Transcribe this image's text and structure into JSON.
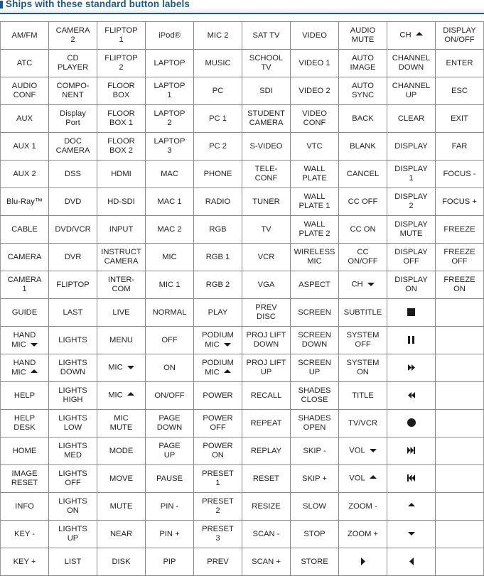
{
  "header": {
    "title": "Ships with these standard button labels",
    "accent_color": "#1a5a8a"
  },
  "table": {
    "columns": 10,
    "rows": [
      [
        {
          "text": "AM/FM"
        },
        {
          "text": "CAMERA\n2"
        },
        {
          "text": "FLIPTOP\n1"
        },
        {
          "text": "iPod®"
        },
        {
          "text": "MIC 2"
        },
        {
          "text": "SAT TV"
        },
        {
          "text": "VIDEO"
        },
        {
          "text": "AUDIO\nMUTE"
        },
        {
          "text": "CH",
          "icon": "triangle-up"
        },
        {
          "text": "DISPLAY\nON/OFF"
        }
      ],
      [
        {
          "text": "ATC"
        },
        {
          "text": "CD\nPLAYER"
        },
        {
          "text": "FLIPTOP\n2"
        },
        {
          "text": "LAPTOP"
        },
        {
          "text": "MUSIC"
        },
        {
          "text": "SCHOOL\nTV"
        },
        {
          "text": "VIDEO 1"
        },
        {
          "text": "AUTO\nIMAGE"
        },
        {
          "text": "CHANNEL\nDOWN"
        },
        {
          "text": "ENTER"
        }
      ],
      [
        {
          "text": "AUDIO\nCONF"
        },
        {
          "text": "COMPO-\nNENT"
        },
        {
          "text": "FLOOR\nBOX"
        },
        {
          "text": "LAPTOP\n1"
        },
        {
          "text": "PC"
        },
        {
          "text": "SDI"
        },
        {
          "text": "VIDEO 2"
        },
        {
          "text": "AUTO\nSYNC"
        },
        {
          "text": "CHANNEL\nUP"
        },
        {
          "text": "ESC"
        }
      ],
      [
        {
          "text": "AUX"
        },
        {
          "text": "Display\nPort"
        },
        {
          "text": "FLOOR\nBOX 1"
        },
        {
          "text": "LAPTOP\n2"
        },
        {
          "text": "PC 1"
        },
        {
          "text": "STUDENT\nCAMERA"
        },
        {
          "text": "VIDEO\nCONF"
        },
        {
          "text": "BACK"
        },
        {
          "text": "CLEAR"
        },
        {
          "text": "EXIT"
        }
      ],
      [
        {
          "text": "AUX 1"
        },
        {
          "text": "DOC\nCAMERA"
        },
        {
          "text": "FLOOR\nBOX 2"
        },
        {
          "text": "LAPTOP\n3"
        },
        {
          "text": "PC 2"
        },
        {
          "text": "S-VIDEO"
        },
        {
          "text": "VTC"
        },
        {
          "text": "BLANK"
        },
        {
          "text": "DISPLAY"
        },
        {
          "text": "FAR"
        }
      ],
      [
        {
          "text": "AUX 2"
        },
        {
          "text": "DSS"
        },
        {
          "text": "HDMI"
        },
        {
          "text": "MAC"
        },
        {
          "text": "PHONE"
        },
        {
          "text": "TELE-\nCONF"
        },
        {
          "text": "WALL\nPLATE"
        },
        {
          "text": "CANCEL"
        },
        {
          "text": "DISPLAY\n1"
        },
        {
          "text": "FOCUS -"
        }
      ],
      [
        {
          "text": "Blu-Ray™"
        },
        {
          "text": "DVD"
        },
        {
          "text": "HD-SDI"
        },
        {
          "text": "MAC 1"
        },
        {
          "text": "RADIO"
        },
        {
          "text": "TUNER"
        },
        {
          "text": "WALL\nPLATE 1"
        },
        {
          "text": "CC OFF"
        },
        {
          "text": "DISPLAY\n2"
        },
        {
          "text": "FOCUS +"
        }
      ],
      [
        {
          "text": "CABLE"
        },
        {
          "text": "DVD/VCR"
        },
        {
          "text": "INPUT"
        },
        {
          "text": "MAC 2"
        },
        {
          "text": "RGB"
        },
        {
          "text": "TV"
        },
        {
          "text": "WALL\nPLATE 2"
        },
        {
          "text": "CC ON"
        },
        {
          "text": "DISPLAY\nMUTE"
        },
        {
          "text": "FREEZE"
        }
      ],
      [
        {
          "text": "CAMERA"
        },
        {
          "text": "DVR"
        },
        {
          "text": "INSTRUCT\nCAMERA"
        },
        {
          "text": "MIC"
        },
        {
          "text": "RGB 1"
        },
        {
          "text": "VCR"
        },
        {
          "text": "WIRELESS\nMIC"
        },
        {
          "text": "CC\nON/OFF"
        },
        {
          "text": "DISPLAY\nOFF"
        },
        {
          "text": "FREEZE\nOFF"
        }
      ],
      [
        {
          "text": "CAMERA\n1"
        },
        {
          "text": "FLIPTOP"
        },
        {
          "text": "INTER-\nCOM"
        },
        {
          "text": "MIC 1"
        },
        {
          "text": "RGB 2"
        },
        {
          "text": "VGA"
        },
        {
          "text": "ASPECT"
        },
        {
          "text": "CH",
          "icon": "triangle-down"
        },
        {
          "text": "DISPLAY\nON"
        },
        {
          "text": "FREEZE\nON"
        }
      ],
      [
        {
          "text": "GUIDE"
        },
        {
          "text": "LAST"
        },
        {
          "text": "LIVE"
        },
        {
          "text": "NORMAL"
        },
        {
          "text": "PLAY"
        },
        {
          "text": "PREV\nDISC"
        },
        {
          "text": "SCREEN"
        },
        {
          "text": "SUBTITLE"
        },
        {
          "text": "",
          "icon": "stop"
        },
        {
          "text": ""
        }
      ],
      [
        {
          "text": "HAND\nMIC",
          "icon": "triangle-down"
        },
        {
          "text": "LIGHTS"
        },
        {
          "text": "MENU"
        },
        {
          "text": "OFF"
        },
        {
          "text": "PODIUM\nMIC",
          "icon": "triangle-down"
        },
        {
          "text": "PROJ LIFT\nDOWN"
        },
        {
          "text": "SCREEN\nDOWN"
        },
        {
          "text": "SYSTEM\nOFF"
        },
        {
          "text": "",
          "icon": "pause"
        },
        {
          "text": ""
        }
      ],
      [
        {
          "text": "HAND\nMIC",
          "icon": "triangle-up"
        },
        {
          "text": "LIGHTS\nDOWN"
        },
        {
          "text": "MIC",
          "icon": "triangle-down"
        },
        {
          "text": "ON"
        },
        {
          "text": "PODIUM\nMIC",
          "icon": "triangle-up"
        },
        {
          "text": "PROJ LIFT\nUP"
        },
        {
          "text": "SCREEN\nUP"
        },
        {
          "text": "SYSTEM\nON"
        },
        {
          "text": "",
          "icon": "fast-forward"
        },
        {
          "text": ""
        }
      ],
      [
        {
          "text": "HELP"
        },
        {
          "text": "LIGHTS\nHIGH"
        },
        {
          "text": "MIC",
          "icon": "triangle-up"
        },
        {
          "text": "ON/OFF"
        },
        {
          "text": "POWER"
        },
        {
          "text": "RECALL"
        },
        {
          "text": "SHADES\nCLOSE"
        },
        {
          "text": "TITLE"
        },
        {
          "text": "",
          "icon": "rewind"
        },
        {
          "text": ""
        }
      ],
      [
        {
          "text": "HELP\nDESK"
        },
        {
          "text": "LIGHTS\nLOW"
        },
        {
          "text": "MIC\nMUTE"
        },
        {
          "text": "PAGE\nDOWN"
        },
        {
          "text": "POWER\nOFF"
        },
        {
          "text": "REPEAT"
        },
        {
          "text": "SHADES\nOPEN"
        },
        {
          "text": "TV/VCR"
        },
        {
          "text": "",
          "icon": "record"
        },
        {
          "text": ""
        }
      ],
      [
        {
          "text": "HOME"
        },
        {
          "text": "LIGHTS\nMED"
        },
        {
          "text": "MODE"
        },
        {
          "text": "PAGE\nUP"
        },
        {
          "text": "POWER\nON"
        },
        {
          "text": "REPLAY"
        },
        {
          "text": "SKIP -"
        },
        {
          "text": "VOL",
          "icon": "triangle-down"
        },
        {
          "text": "",
          "icon": "skip-next"
        },
        {
          "text": ""
        }
      ],
      [
        {
          "text": "IMAGE\nRESET"
        },
        {
          "text": "LIGHTS\nOFF"
        },
        {
          "text": "MOVE"
        },
        {
          "text": "PAUSE"
        },
        {
          "text": "PRESET\n1"
        },
        {
          "text": "RESET"
        },
        {
          "text": "SKIP +"
        },
        {
          "text": "VOL",
          "icon": "triangle-up"
        },
        {
          "text": "",
          "icon": "skip-previous"
        },
        {
          "text": ""
        }
      ],
      [
        {
          "text": "INFO"
        },
        {
          "text": "LIGHTS\nON"
        },
        {
          "text": "MUTE"
        },
        {
          "text": "PIN -"
        },
        {
          "text": "PRESET\n2"
        },
        {
          "text": "RESIZE"
        },
        {
          "text": "SLOW"
        },
        {
          "text": "ZOOM -"
        },
        {
          "text": "",
          "icon": "triangle-up"
        },
        {
          "text": ""
        }
      ],
      [
        {
          "text": "KEY -"
        },
        {
          "text": "LIGHTS\nUP"
        },
        {
          "text": "NEAR"
        },
        {
          "text": "PIN +"
        },
        {
          "text": "PRESET\n3"
        },
        {
          "text": "SCAN -"
        },
        {
          "text": "STOP"
        },
        {
          "text": "ZOOM +"
        },
        {
          "text": "",
          "icon": "triangle-down"
        },
        {
          "text": ""
        }
      ],
      [
        {
          "text": "KEY +"
        },
        {
          "text": "LIST"
        },
        {
          "text": "DISK"
        },
        {
          "text": "PIP"
        },
        {
          "text": "PREV"
        },
        {
          "text": "SCAN +"
        },
        {
          "text": "STORE"
        },
        {
          "text": "",
          "icon": "triangle-right"
        },
        {
          "text": "",
          "icon": "triangle-left"
        },
        {
          "text": ""
        }
      ]
    ]
  }
}
